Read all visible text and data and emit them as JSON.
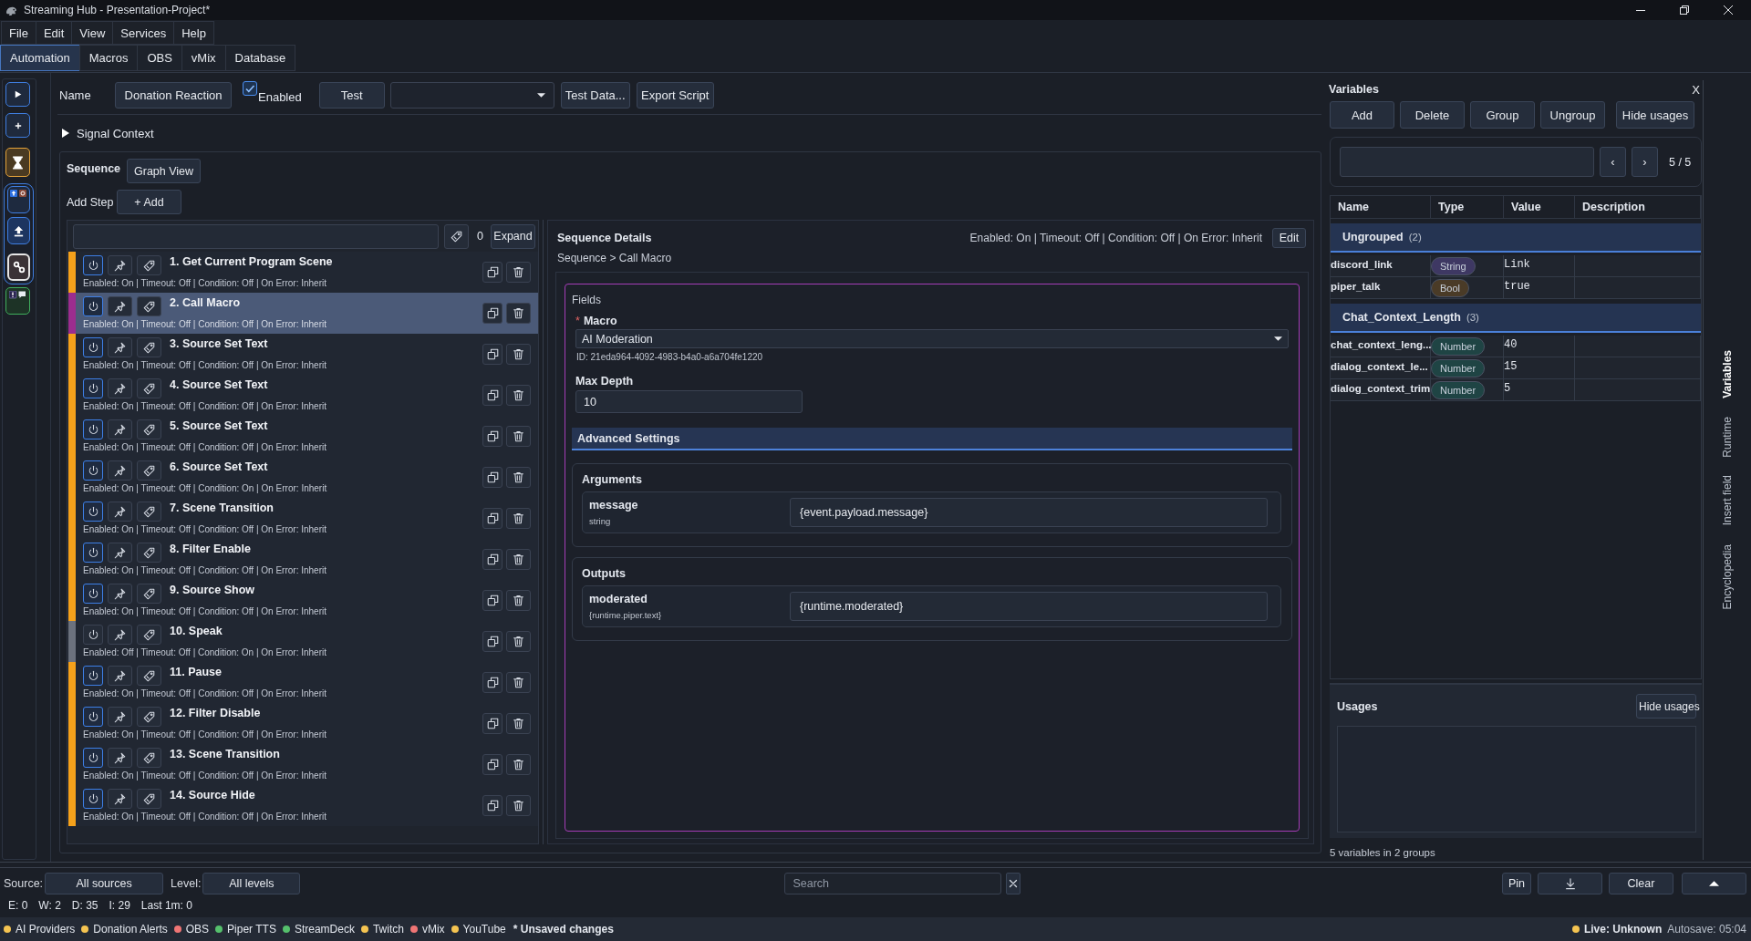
{
  "window": {
    "title": "Streaming Hub - Presentation-Project*"
  },
  "menu": [
    "File",
    "Edit",
    "View",
    "Services",
    "Help"
  ],
  "tabs": [
    {
      "label": "Automation",
      "selected": true
    },
    {
      "label": "Macros",
      "selected": false
    },
    {
      "label": "OBS",
      "selected": false
    },
    {
      "label": "vMix",
      "selected": false
    },
    {
      "label": "Database",
      "selected": false
    }
  ],
  "automation": {
    "name_label": "Name",
    "name_value": "Donation Reaction",
    "enabled": {
      "label": "Enabled",
      "checked": true
    },
    "test_button": "Test",
    "test_data_button": "Test Data...",
    "export_button": "Export Script",
    "signal_context": {
      "label": "Signal Context",
      "expanded": false
    }
  },
  "sequence": {
    "title": "Sequence",
    "graph_view_button": "Graph View",
    "add_step_label": "Add Step",
    "add_button": "+ Add",
    "filter_count": "0",
    "expand_button": "Expand",
    "steps": [
      {
        "title": "1. Get Current Program Scene",
        "summary": "Enabled: On | Timeout: Off | Condition: Off | On Error: Inherit",
        "enabled": true,
        "selected": false
      },
      {
        "title": "2. Call Macro",
        "summary": "Enabled: On | Timeout: Off | Condition: Off | On Error: Inherit",
        "enabled": true,
        "selected": true
      },
      {
        "title": "3. Source Set Text",
        "summary": "Enabled: On | Timeout: Off | Condition: Off | On Error: Inherit",
        "enabled": true,
        "selected": false
      },
      {
        "title": "4. Source Set Text",
        "summary": "Enabled: On | Timeout: Off | Condition: Off | On Error: Inherit",
        "enabled": true,
        "selected": false
      },
      {
        "title": "5. Source Set Text",
        "summary": "Enabled: On | Timeout: Off | Condition: Off | On Error: Inherit",
        "enabled": true,
        "selected": false
      },
      {
        "title": "6. Source Set Text",
        "summary": "Enabled: On | Timeout: Off | Condition: On | On Error: Inherit",
        "enabled": true,
        "selected": false
      },
      {
        "title": "7. Scene Transition",
        "summary": "Enabled: On | Timeout: Off | Condition: Off | On Error: Inherit",
        "enabled": true,
        "selected": false
      },
      {
        "title": "8. Filter Enable",
        "summary": "Enabled: On | Timeout: Off | Condition: Off | On Error: Inherit",
        "enabled": true,
        "selected": false
      },
      {
        "title": "9. Source Show",
        "summary": "Enabled: On | Timeout: Off | Condition: Off | On Error: Inherit",
        "enabled": true,
        "selected": false
      },
      {
        "title": "10. Speak",
        "summary": "Enabled: Off | Timeout: Off | Condition: On | On Error: Inherit",
        "enabled": false,
        "selected": false
      },
      {
        "title": "11. Pause",
        "summary": "Enabled: On | Timeout: Off | Condition: Off | On Error: Inherit",
        "enabled": true,
        "selected": false
      },
      {
        "title": "12. Filter Disable",
        "summary": "Enabled: On | Timeout: Off | Condition: Off | On Error: Inherit",
        "enabled": true,
        "selected": false
      },
      {
        "title": "13. Scene Transition",
        "summary": "Enabled: On | Timeout: Off | Condition: Off | On Error: Inherit",
        "enabled": true,
        "selected": false
      },
      {
        "title": "14. Source Hide",
        "summary": "Enabled: On | Timeout: Off | Condition: Off | On Error: Inherit",
        "enabled": true,
        "selected": false
      }
    ]
  },
  "details": {
    "title": "Sequence Details",
    "summary": "Enabled: On | Timeout: Off | Condition: Off | On Error: Inherit",
    "edit_button": "Edit",
    "breadcrumb": "Sequence > Call Macro",
    "fields_label": "Fields",
    "macro": {
      "required_mark": "*",
      "label": "Macro",
      "value": "AI Moderation",
      "id": "ID: 21eda964-4092-4983-b4a0-a6a704fe1220"
    },
    "max_depth": {
      "label": "Max Depth",
      "value": "10"
    },
    "advanced_settings": "Advanced Settings",
    "arguments": {
      "title": "Arguments",
      "rows": [
        {
          "name": "message",
          "type": "string",
          "value": "{event.payload.message}"
        }
      ]
    },
    "outputs": {
      "title": "Outputs",
      "rows": [
        {
          "name": "moderated",
          "type": "{runtime.piper.text}",
          "value": "{runtime.moderated}"
        }
      ]
    }
  },
  "variables": {
    "title": "Variables",
    "close": "X",
    "buttons": [
      "Add",
      "Delete",
      "Group",
      "Ungroup",
      "Hide usages"
    ],
    "prev": "‹",
    "next": "›",
    "page": "5 / 5",
    "columns": [
      "Name",
      "Type",
      "Value",
      "Description"
    ],
    "groups": [
      {
        "name": "Ungrouped",
        "count": "(2)",
        "rows": [
          {
            "name": "discord_link",
            "type": {
              "label": "String",
              "color": "#3e3863"
            },
            "value": "Link"
          },
          {
            "name": "piper_talk",
            "type": {
              "label": "Bool",
              "color": "#4a3b27"
            },
            "value": "true"
          }
        ]
      },
      {
        "name": "Chat_Context_Length",
        "count": "(3)",
        "rows": [
          {
            "name": "chat_context_leng...",
            "type": {
              "label": "Number",
              "color": "#1f4444"
            },
            "value": "40"
          },
          {
            "name": "dialog_context_le...",
            "type": {
              "label": "Number",
              "color": "#1f4444"
            },
            "value": "15"
          },
          {
            "name": "dialog_context_trim",
            "type": {
              "label": "Number",
              "color": "#1f4444"
            },
            "value": "5"
          }
        ]
      }
    ],
    "usages": {
      "title": "Usages",
      "button": "Hide usages"
    },
    "footer": "5 variables in 2 groups"
  },
  "side_tabs": [
    {
      "label": "Variables",
      "selected": true
    },
    {
      "label": "Runtime",
      "selected": false
    },
    {
      "label": "Insert field",
      "selected": false
    },
    {
      "label": "Encyclopedia",
      "selected": false
    }
  ],
  "log": {
    "source_label": "Source:",
    "source_value": "All sources",
    "level_label": "Level:",
    "level_value": "All levels",
    "search": {
      "placeholder": "Search"
    },
    "pin_button": "Pin",
    "clear_button": "Clear",
    "stats": [
      "E: 0",
      "W: 2",
      "D: 35",
      "I: 29",
      "Last 1m: 0"
    ]
  },
  "status_bar": {
    "services": [
      {
        "label": "AI Providers",
        "color": "#f5c451"
      },
      {
        "label": "Donation Alerts",
        "color": "#f5c451"
      },
      {
        "label": "OBS",
        "color": "#f07575"
      },
      {
        "label": "Piper TTS",
        "color": "#55c06c"
      },
      {
        "label": "StreamDeck",
        "color": "#55c06c"
      },
      {
        "label": "Twitch",
        "color": "#f5c451"
      },
      {
        "label": "vMix",
        "color": "#f07575"
      },
      {
        "label": "YouTube",
        "color": "#f5c451"
      }
    ],
    "unsaved": "* Unsaved changes",
    "live": {
      "label": "Live: Unknown",
      "color": "#f5c451"
    },
    "autosave": "Autosave: 05:04"
  }
}
